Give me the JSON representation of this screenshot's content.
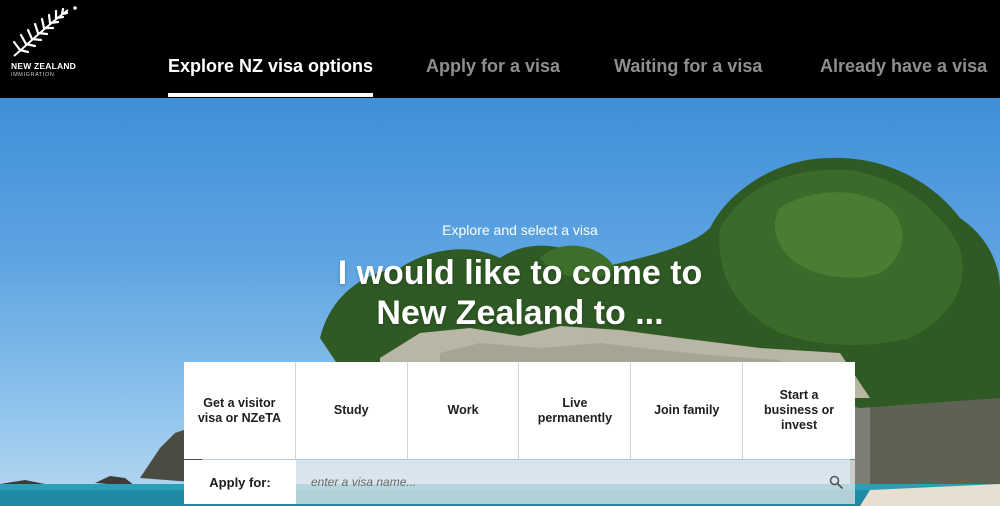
{
  "brand": {
    "name": "NEW ZEALAND",
    "subtitle": "IMMIGRATION"
  },
  "nav": {
    "tabs": [
      {
        "label": "Explore NZ visa options",
        "active": true
      },
      {
        "label": "Apply for a visa",
        "active": false
      },
      {
        "label": "Waiting for a visa",
        "active": false
      },
      {
        "label": "Already have a visa",
        "active": false
      }
    ]
  },
  "hero": {
    "subtitle": "Explore and select a visa",
    "title": "I would like to come to New Zealand to ..."
  },
  "categories": [
    {
      "label": "Get a visitor visa or NZeTA"
    },
    {
      "label": "Study"
    },
    {
      "label": "Work"
    },
    {
      "label": "Live permanently"
    },
    {
      "label": "Join family"
    },
    {
      "label": "Start a business or invest"
    }
  ],
  "apply": {
    "label": "Apply for:",
    "placeholder": "enter a visa name..."
  },
  "icons": {
    "logo": "silver-fern-icon",
    "search": "search-icon"
  },
  "colors": {
    "header_bg": "#000000",
    "active_tab": "#ffffff",
    "inactive_tab": "#8e8e8e"
  }
}
